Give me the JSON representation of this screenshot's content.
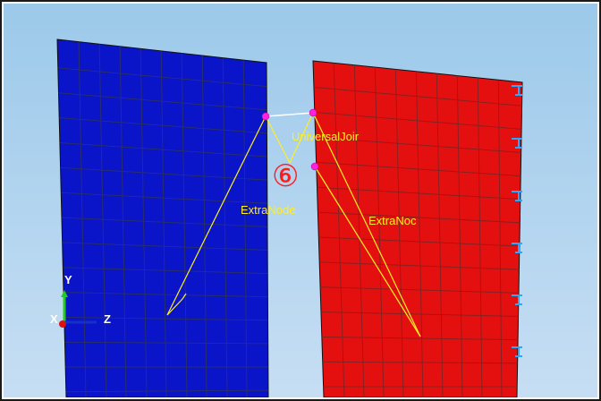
{
  "scene": {
    "background_color": "#b6d6f0",
    "left_panel_color": "#0a14c8",
    "right_panel_color": "#e41010",
    "mesh_line_color": "#3a3a3a",
    "connector_color": "#ffee22",
    "node_color": "#ff22dd",
    "constraint_color": "#33aaff"
  },
  "labels": {
    "joint": "UniversalJoir",
    "extra_node_left": "ExtraNode",
    "extra_node_right": "ExtraNoc",
    "step_marker": "⑥"
  },
  "triad": {
    "y": "Y",
    "x": "X",
    "z": "Z"
  }
}
